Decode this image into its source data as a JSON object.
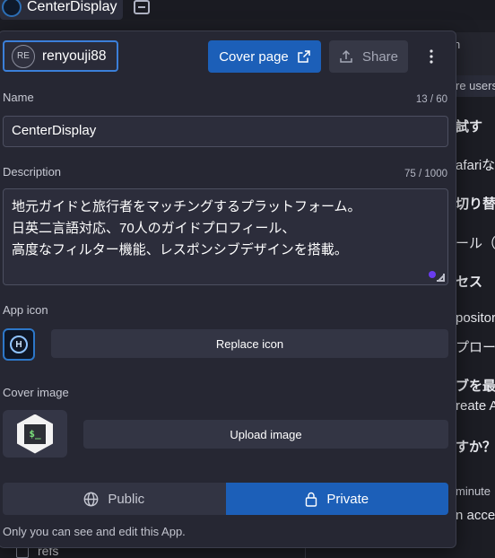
{
  "window": {
    "app_title": "CenterDisplay",
    "app_tab_icon": "app-avatar-icon",
    "extra_icon": "panel-icon"
  },
  "background": {
    "right_fragments": [
      "n",
      "re users",
      "試す",
      "afariな",
      "切り替",
      "ール（",
      "セス",
      "pository",
      "プロー",
      "ブを最",
      "reate A",
      "すか？",
      " minute",
      "n access"
    ],
    "bottom_item": "refs"
  },
  "panel": {
    "owner": {
      "initials": "RE",
      "name": "renyouji88"
    },
    "cover_page_label": "Cover page",
    "share_label": "Share",
    "more_icon": "more-vertical-icon",
    "name": {
      "label": "Name",
      "counter": "13 / 60",
      "value": "CenterDisplay"
    },
    "description": {
      "label": "Description",
      "counter": "75 / 1000",
      "lines": [
        "地元ガイドと旅行者をマッチングするプラットフォーム。",
        "日英二言語対応、70人のガイドプロフィール、",
        "高度なフィルター機能、レスポンシブデザインを搭載。"
      ]
    },
    "app_icon": {
      "label": "App icon",
      "replace_label": "Replace icon"
    },
    "cover_image": {
      "label": "Cover image",
      "upload_label": "Upload image",
      "glyph": "$_"
    },
    "visibility": {
      "public_label": "Public",
      "private_label": "Private",
      "selected": "private",
      "helper": "Only you can see and edit this App."
    }
  },
  "colors": {
    "accent": "#1c5fb8",
    "panel_bg": "#262733",
    "focus": "#3b7fd9"
  }
}
